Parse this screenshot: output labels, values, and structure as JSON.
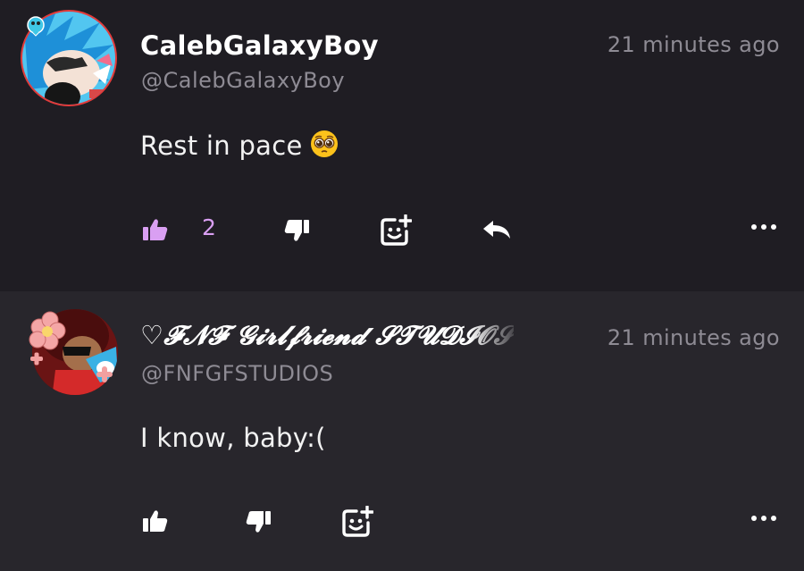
{
  "comments": [
    {
      "display_name": "CalebGalaxyBoy",
      "handle": "@CalebGalaxyBoy",
      "timestamp": "21 minutes ago",
      "text": "Rest in pace",
      "emoji": "pleading-face",
      "likes": "2",
      "liked": true,
      "accent_color": "#d99ff2"
    },
    {
      "display_name": "♡𝓕𝓝𝓕 𝓖𝓲𝓻𝓵𝓯𝓻𝓲𝓮𝓷𝓭 𝓢𝓣𝓤𝓓𝓘𝓞𝓢",
      "display_name_plain": "♡FNF Girlfriend STUDIOS",
      "handle": "@FNFGFSTUDIOS",
      "timestamp": "21 minutes ago",
      "text": "I know, baby:(",
      "liked": false
    }
  ],
  "icons": {
    "like": "thumbs-up-icon",
    "dislike": "thumbs-down-icon",
    "react": "add-reaction-icon",
    "reply": "reply-arrow-icon",
    "more": "more-options-icon"
  },
  "colors": {
    "background": "#1f1d23",
    "second_comment_background": "#28262c",
    "muted_text": "#8e8b94",
    "like_active": "#d99ff2"
  }
}
